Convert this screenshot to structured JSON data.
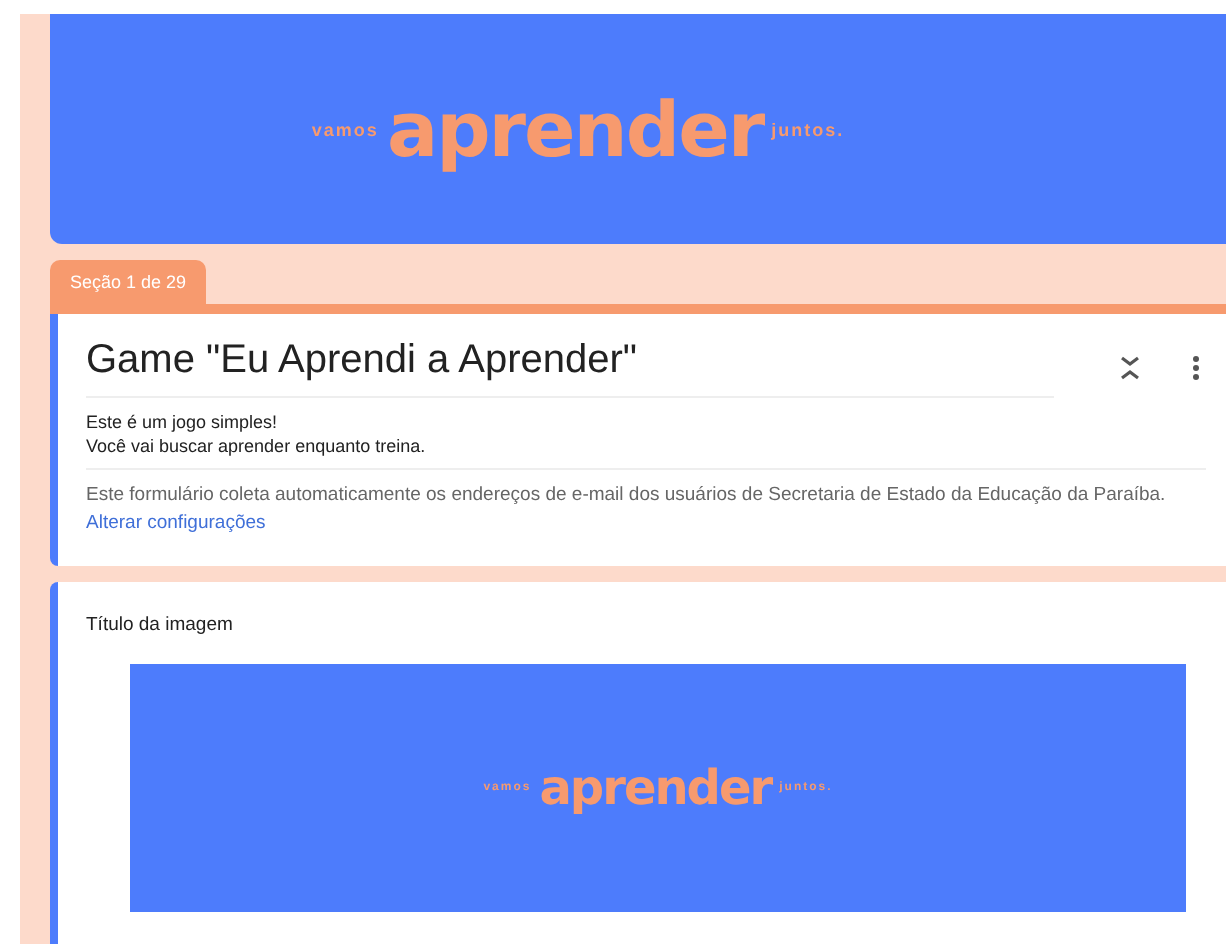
{
  "header_banner": {
    "small_left": "vamos",
    "big": "aprender",
    "small_right": "juntos."
  },
  "section_tab": {
    "label": "Seção 1 de 29"
  },
  "form_card": {
    "title": "Game \"Eu Aprendi a Aprender\"",
    "description": [
      "Este é um jogo simples!",
      "Você vai buscar aprender enquanto treina."
    ],
    "notice": "Este formulário coleta automaticamente os endereços de e-mail dos usuários de Secretaria de Estado da Educação da Paraíba.",
    "notice_link": "Alterar configurações"
  },
  "image_card": {
    "title": "Título da imagem",
    "banner": {
      "small_left": "vamos",
      "big": "aprender",
      "small_right": "juntos."
    }
  }
}
